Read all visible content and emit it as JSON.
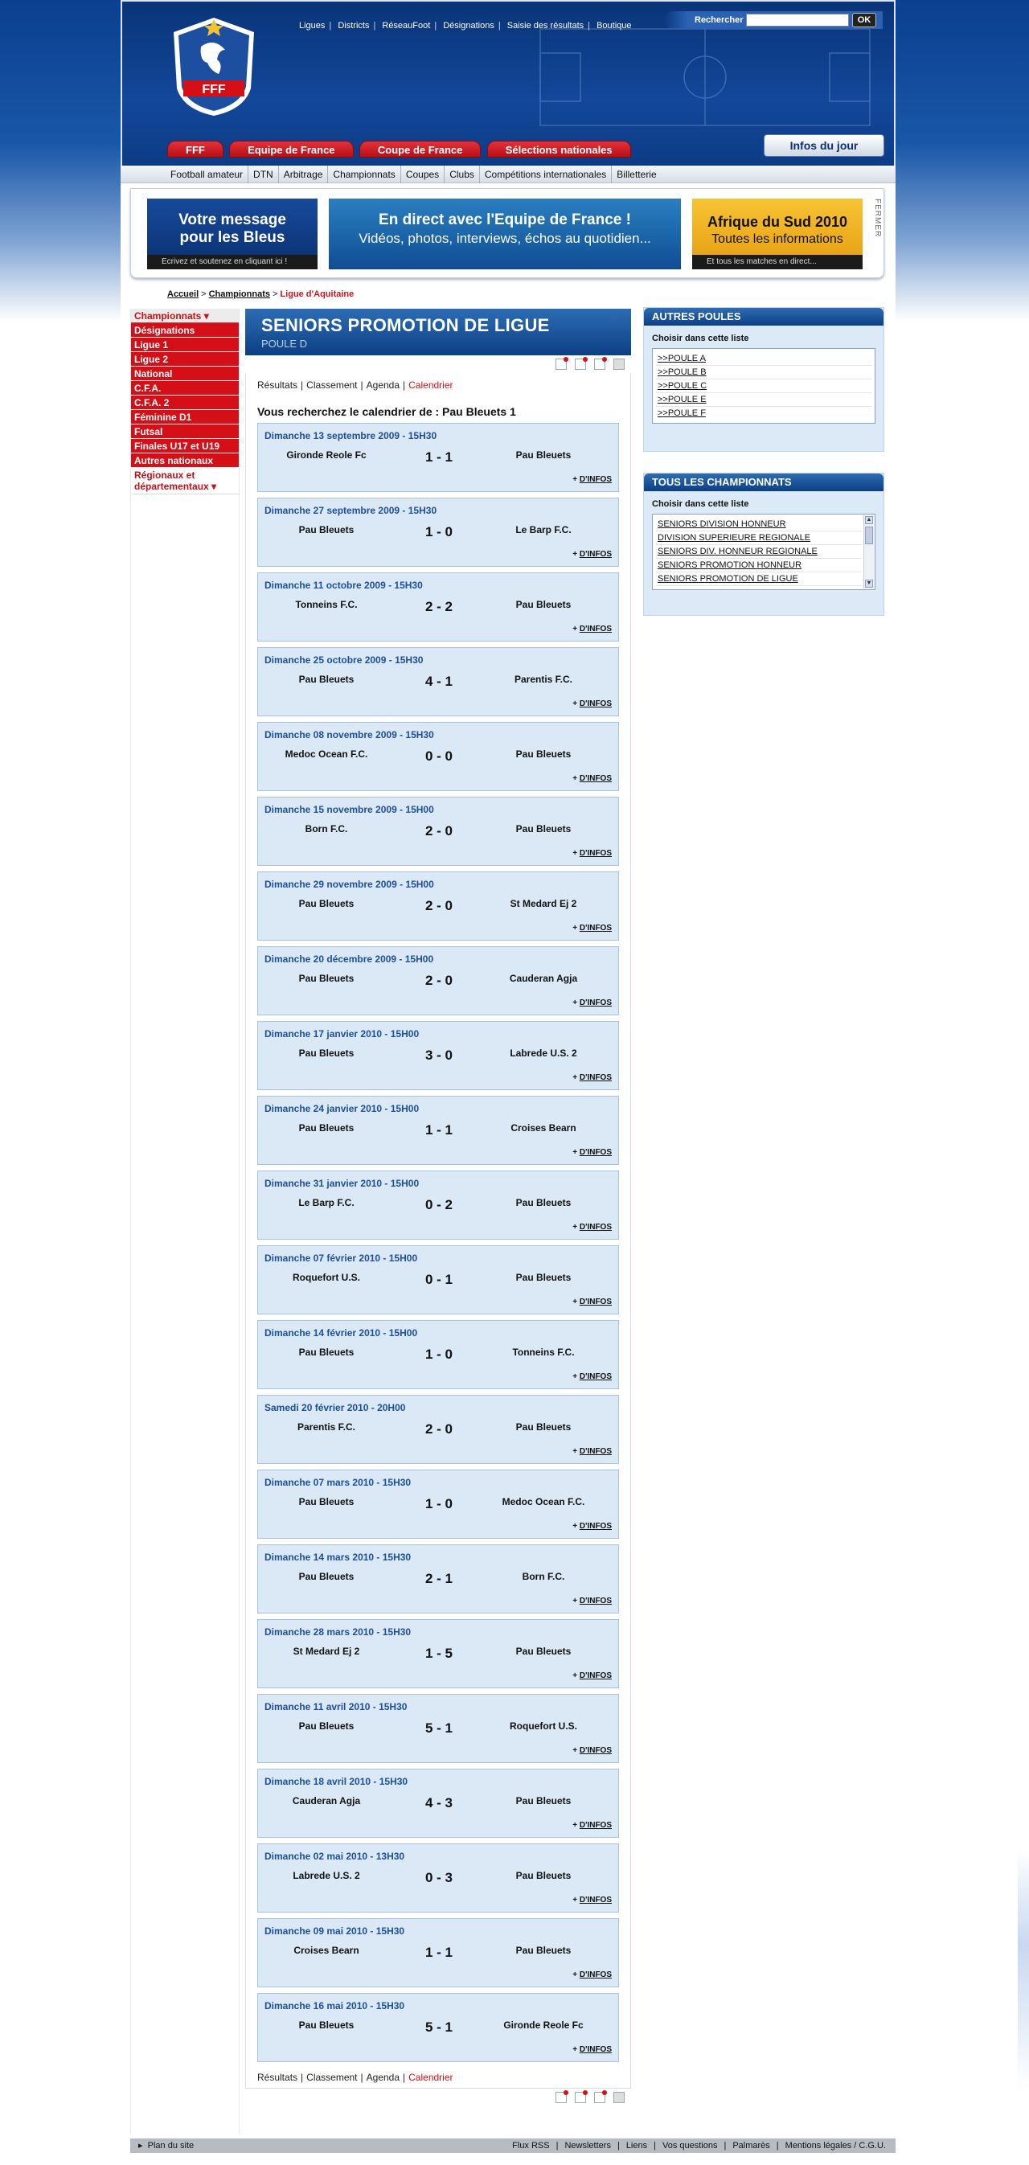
{
  "header": {
    "top_links": [
      "Ligues",
      "Districts",
      "RéseauFoot",
      "Désignations",
      "Saisie des résultats",
      "Boutique"
    ],
    "search_label": "Rechercher",
    "search_value": "",
    "ok_label": "OK",
    "logo_text": "FFF",
    "red_tabs": [
      "FFF",
      "Equipe de France",
      "Coupe de France",
      "Sélections nationales"
    ],
    "infos_du_jour": "Infos du jour",
    "subnav": [
      "Football amateur",
      "DTN",
      "Arbitrage",
      "Championnats",
      "Coupes",
      "Clubs",
      "Compétitions internationales",
      "Billetterie"
    ]
  },
  "banners": {
    "b1": {
      "title": "Votre message",
      "line2": "pour les Bleus",
      "foot": "Ecrivez et soutenez en cliquant ici !"
    },
    "b2": {
      "title": "En direct avec l'Equipe de France !",
      "line2": "Vidéos, photos, interviews, échos au quotidien..."
    },
    "b3": {
      "title": "Afrique du Sud 2010",
      "line2": "Toutes les informations",
      "foot": "Et tous les matches en direct..."
    },
    "close": "FERMER"
  },
  "breadcrumb": {
    "home": "Accueil",
    "section": "Championnats",
    "current": "Ligue d'Aquitaine"
  },
  "leftnav": {
    "head": "Championnats",
    "items": [
      "Désignations",
      "Ligue 1",
      "Ligue 2",
      "National",
      "C.F.A.",
      "C.F.A. 2",
      "Féminine D1",
      "Futsal",
      "Finales U17 et U19",
      "Autres nationaux"
    ],
    "regional": "Régionaux et départementaux"
  },
  "main": {
    "title": "SENIORS PROMOTION DE LIGUE",
    "subtitle": "POULE D",
    "tabs": [
      "Résultats",
      "Classement",
      "Agenda",
      "Calendrier"
    ],
    "search_text": "Vous recherchez le calendrier de : Pau Bleuets 1",
    "more_plus": "+ ",
    "more_label": "D'INFOS",
    "matches": [
      {
        "date": "Dimanche 13 septembre 2009 - 15H30",
        "home": "Gironde Reole Fc",
        "score": "1 - 1",
        "away": "Pau Bleuets"
      },
      {
        "date": "Dimanche 27 septembre 2009 - 15H30",
        "home": "Pau Bleuets",
        "score": "1 - 0",
        "away": "Le Barp F.C."
      },
      {
        "date": "Dimanche 11 octobre 2009 - 15H30",
        "home": "Tonneins F.C.",
        "score": "2 - 2",
        "away": "Pau Bleuets"
      },
      {
        "date": "Dimanche 25 octobre 2009 - 15H30",
        "home": "Pau Bleuets",
        "score": "4 - 1",
        "away": "Parentis F.C."
      },
      {
        "date": "Dimanche 08 novembre 2009 - 15H30",
        "home": "Medoc Ocean F.C.",
        "score": "0 - 0",
        "away": "Pau Bleuets"
      },
      {
        "date": "Dimanche 15 novembre 2009 - 15H00",
        "home": "Born F.C.",
        "score": "2 - 0",
        "away": "Pau Bleuets"
      },
      {
        "date": "Dimanche 29 novembre 2009 - 15H00",
        "home": "Pau Bleuets",
        "score": "2 - 0",
        "away": "St Medard Ej 2"
      },
      {
        "date": "Dimanche 20 décembre 2009 - 15H00",
        "home": "Pau Bleuets",
        "score": "2 - 0",
        "away": "Cauderan Agja"
      },
      {
        "date": "Dimanche 17 janvier 2010 - 15H00",
        "home": "Pau Bleuets",
        "score": "3 - 0",
        "away": "Labrede U.S. 2"
      },
      {
        "date": "Dimanche 24 janvier 2010 - 15H00",
        "home": "Pau Bleuets",
        "score": "1 - 1",
        "away": "Croises Bearn"
      },
      {
        "date": "Dimanche 31 janvier 2010 - 15H00",
        "home": "Le Barp F.C.",
        "score": "0 - 2",
        "away": "Pau Bleuets"
      },
      {
        "date": "Dimanche 07 février 2010 - 15H00",
        "home": "Roquefort U.S.",
        "score": "0 - 1",
        "away": "Pau Bleuets"
      },
      {
        "date": "Dimanche 14 février 2010 - 15H00",
        "home": "Pau Bleuets",
        "score": "1 - 0",
        "away": "Tonneins F.C."
      },
      {
        "date": "Samedi 20 février 2010 - 20H00",
        "home": "Parentis F.C.",
        "score": "2 - 0",
        "away": "Pau Bleuets"
      },
      {
        "date": "Dimanche 07 mars 2010 - 15H30",
        "home": "Pau Bleuets",
        "score": "1 - 0",
        "away": "Medoc Ocean F.C."
      },
      {
        "date": "Dimanche 14 mars 2010 - 15H30",
        "home": "Pau Bleuets",
        "score": "2 - 1",
        "away": "Born F.C."
      },
      {
        "date": "Dimanche 28 mars 2010 - 15H30",
        "home": "St Medard Ej 2",
        "score": "1 - 5",
        "away": "Pau Bleuets"
      },
      {
        "date": "Dimanche 11 avril 2010 - 15H30",
        "home": "Pau Bleuets",
        "score": "5 - 1",
        "away": "Roquefort U.S."
      },
      {
        "date": "Dimanche 18 avril 2010 - 15H30",
        "home": "Cauderan Agja",
        "score": "4 - 3",
        "away": "Pau Bleuets"
      },
      {
        "date": "Dimanche 02 mai 2010 - 13H30",
        "home": "Labrede U.S. 2",
        "score": "0 - 3",
        "away": "Pau Bleuets"
      },
      {
        "date": "Dimanche 09 mai 2010 - 15H30",
        "home": "Croises Bearn",
        "score": "1 - 1",
        "away": "Pau Bleuets"
      },
      {
        "date": "Dimanche 16 mai 2010 - 15H30",
        "home": "Pau Bleuets",
        "score": "5 - 1",
        "away": "Gironde Reole Fc"
      }
    ]
  },
  "right": {
    "autres_poules": {
      "title": "AUTRES POULES",
      "label": "Choisir dans cette liste",
      "items": [
        ">>POULE A",
        ">>POULE B",
        ">>POULE C",
        ">>POULE E",
        ">>POULE F"
      ]
    },
    "championnats": {
      "title": "TOUS LES CHAMPIONNATS",
      "label": "Choisir dans cette liste",
      "items": [
        "SENIORS DIVISION HONNEUR",
        "DIVISION SUPERIEURE REGIONALE",
        "SENIORS DIV. HONNEUR REGIONALE",
        "SENIORS PROMOTION HONNEUR",
        "SENIORS PROMOTION DE LIGUE"
      ]
    }
  },
  "footer": {
    "plan": "Plan du site",
    "links": [
      "Flux RSS",
      "Newsletters",
      "Liens",
      "Vos questions",
      "Palmarès",
      "Mentions légales / C.G.U."
    ]
  },
  "colors": {
    "brand_blue": "#0c3f84",
    "brand_red": "#d40f18",
    "match_bg": "#dbe8f6"
  }
}
